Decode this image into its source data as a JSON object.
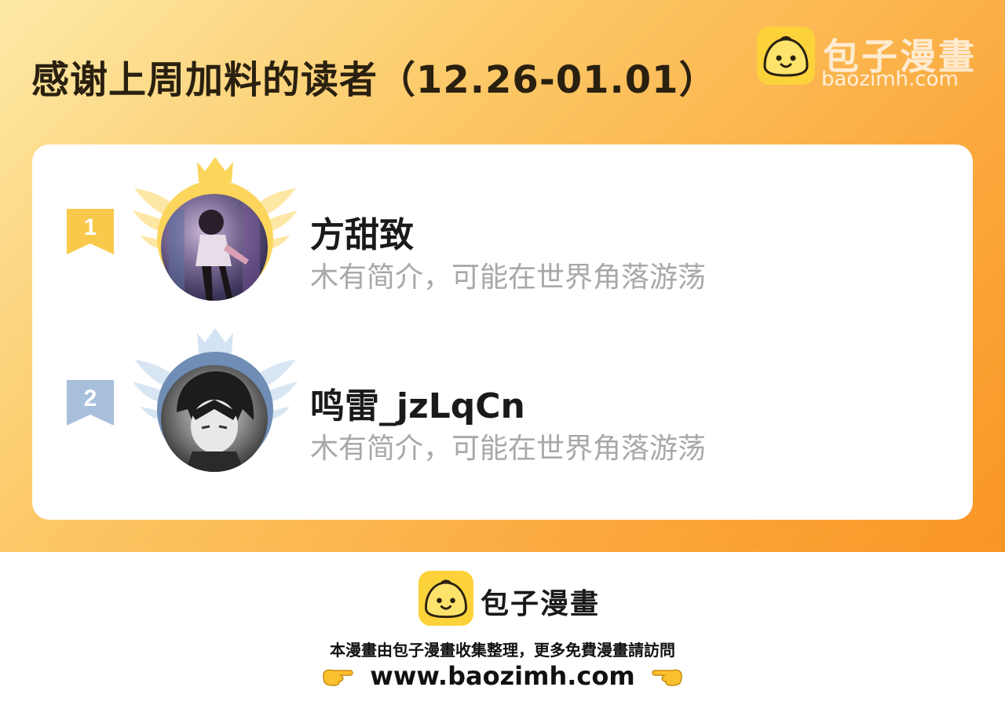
{
  "header": {
    "title": "感谢上周加料的读者（12.26-01.01）"
  },
  "brand": {
    "name": "包子漫畫",
    "url": "baozimh.com",
    "logo_icon": "bun-logo-icon"
  },
  "ranking": [
    {
      "rank": "1",
      "name": "方甜致",
      "bio": "木有简介，可能在世界角落游荡",
      "badge_color": "#f8c94a",
      "frame_color": "#fad15a"
    },
    {
      "rank": "2",
      "name": "鸣雷_jzLqCn",
      "bio": "木有简介，可能在世界角落游荡",
      "badge_color": "#a8bfdc",
      "frame_color": "#6f8db5"
    }
  ],
  "footer": {
    "brand_name": "包子漫畫",
    "note": "本漫畫由包子漫畫收集整理，更多免費漫畫請訪問",
    "url": "www.baozimh.com",
    "left_icon": "pointing-right-hand-icon",
    "right_icon": "pointing-left-hand-icon"
  }
}
